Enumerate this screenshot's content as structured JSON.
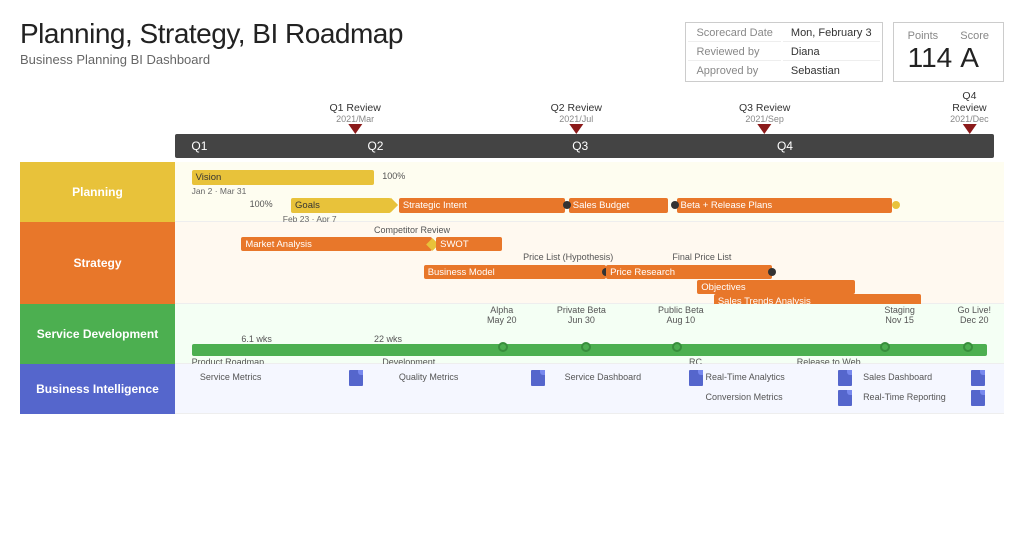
{
  "header": {
    "title": "Planning, Strategy, BI Roadmap",
    "subtitle": "Business Planning BI Dashboard",
    "scorecard": {
      "label": "Scorecard Date",
      "date": "Mon, February 3",
      "reviewed_label": "Reviewed by",
      "reviewed": "Diana",
      "approved_label": "Approved by",
      "approved": "Sebastian"
    },
    "points_label": "Points",
    "points_value": "114",
    "score_label": "Score",
    "score_value": "A"
  },
  "timeline": {
    "q1_label": "Q1",
    "q2_label": "Q2",
    "q3_label": "Q3",
    "q4_label": "Q4",
    "q1_review": "Q1 Review",
    "q1_review_date": "2021/Mar",
    "q2_review": "Q2 Review",
    "q2_review_date": "2021/Jul",
    "q3_review": "Q3 Review",
    "q3_review_date": "2021/Sep",
    "q4_review": "Q4 Review",
    "q4_review_date": "2021/Dec"
  },
  "rows": {
    "planning": {
      "label": "Planning",
      "bars": [
        {
          "text": "Vision",
          "type": "yellow"
        },
        {
          "text": "Goals",
          "type": "yellow"
        },
        {
          "text": "Strategic Intent",
          "type": "orange"
        },
        {
          "text": "Sales Budget",
          "type": "orange"
        },
        {
          "text": "Beta + Release Plans",
          "type": "orange"
        }
      ]
    },
    "strategy": {
      "label": "Strategy",
      "bars": [
        {
          "text": "Market Analysis",
          "type": "orange"
        },
        {
          "text": "SWOT",
          "type": "orange"
        },
        {
          "text": "Business Model",
          "type": "orange"
        },
        {
          "text": "Price Research",
          "type": "orange"
        },
        {
          "text": "Objectives",
          "type": "orange"
        },
        {
          "text": "Sales Trends Analysis",
          "type": "orange"
        }
      ]
    },
    "service": {
      "label": "Service Development",
      "bars": [
        {
          "text": "Product Roadmap",
          "type": "green"
        },
        {
          "text": "Development",
          "type": "green"
        },
        {
          "text": "RC",
          "type": "green"
        },
        {
          "text": "Release to Web",
          "type": "green"
        }
      ]
    },
    "bi": {
      "label": "Business Intelligence",
      "items": [
        "Service Metrics",
        "Quality Metrics",
        "Service Dashboard",
        "Real-Time Analytics",
        "Conversion Metrics",
        "Sales Dashboard",
        "Real-Time Reporting"
      ]
    }
  }
}
